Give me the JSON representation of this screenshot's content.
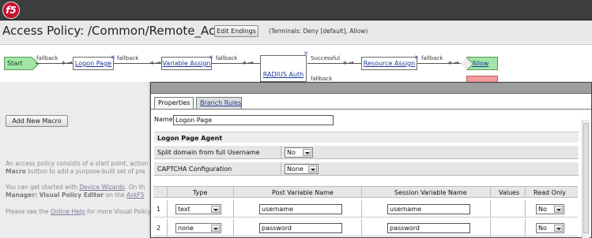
{
  "app": {
    "logo": "f5",
    "logo_icon": "f5-logo-icon"
  },
  "header": {
    "title": "Access Policy: /Common/Remote_Access",
    "edit_endings": "Edit Endings",
    "terminals": "(Terminals: Deny [default], Allow)"
  },
  "flow": {
    "start": "Start",
    "nodes": [
      "Logon Page",
      "Variable Assign",
      "RADIUS Auth",
      "Resource Assign",
      "Allow"
    ],
    "branches": [
      "fallback",
      "fallback",
      "fallback",
      "Successful",
      "fallback",
      "fallback"
    ],
    "plus": "+",
    "arrow": "→",
    "close": "✕"
  },
  "left": {
    "add_macro": "Add New Macro",
    "p1_line1": "An access policy consists of a start point, action",
    "p1_line2_bold": "Macro",
    "p1_line2_rest": " button to add a purpose-built set of pre",
    "p2_line1_a": "You can get started with ",
    "p2_line1_link": "Device Wizards",
    "p2_line1_b": ". On th",
    "p2_line2_bold": "Manager: Visual Policy Editor",
    "p2_line2_mid": " on the ",
    "p2_line2_link": "AskF5",
    "p3_a": "Please see the ",
    "p3_link": "Online Help",
    "p3_b": " for more Visual Policy"
  },
  "dialog": {
    "tabs": [
      "Properties",
      "Branch Rules"
    ],
    "name_label": "Name:",
    "name_value": "Logon Page",
    "section_title": "Logon Page Agent",
    "properties": [
      {
        "label": "Split domain from full Username",
        "value": "No"
      },
      {
        "label": "CAPTCHA Configuration",
        "value": "None"
      }
    ],
    "table": {
      "headers": [
        "Type",
        "Post Variable Name",
        "Session Variable Name",
        "Values",
        "Read Only"
      ],
      "rows": [
        {
          "num": "1",
          "type": "text",
          "post": "username",
          "session": "username",
          "readonly": "No"
        },
        {
          "num": "2",
          "type": "none",
          "post": "password",
          "session": "password",
          "readonly": "No"
        }
      ]
    }
  }
}
